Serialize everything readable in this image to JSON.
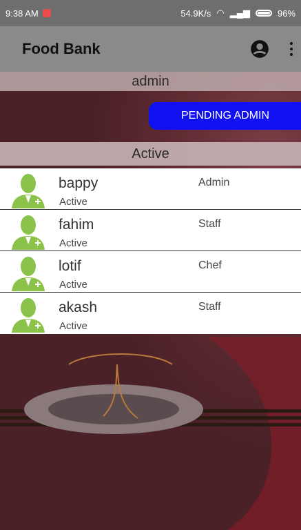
{
  "status_bar": {
    "time": "9:38 AM",
    "speed": "54.9K/s",
    "battery": "96%"
  },
  "app_bar": {
    "title": "Food Bank",
    "account_icon": "account-circle-icon",
    "menu_icon": "more-vert-icon"
  },
  "section_admin": {
    "label": "admin"
  },
  "pending_button": {
    "label": "PENDING ADMIN"
  },
  "section_active": {
    "label": "Active"
  },
  "users": [
    {
      "name": "bappy",
      "status": "Active",
      "role": "Admin"
    },
    {
      "name": "fahim",
      "status": "Active",
      "role": "Staff"
    },
    {
      "name": "lotif",
      "status": "Active",
      "role": "Chef"
    },
    {
      "name": "akash",
      "status": "Active",
      "role": "Staff"
    }
  ],
  "colors": {
    "button": "#1010f0",
    "avatar": "#8bc34a",
    "app_bar": "#8a8a8a"
  }
}
